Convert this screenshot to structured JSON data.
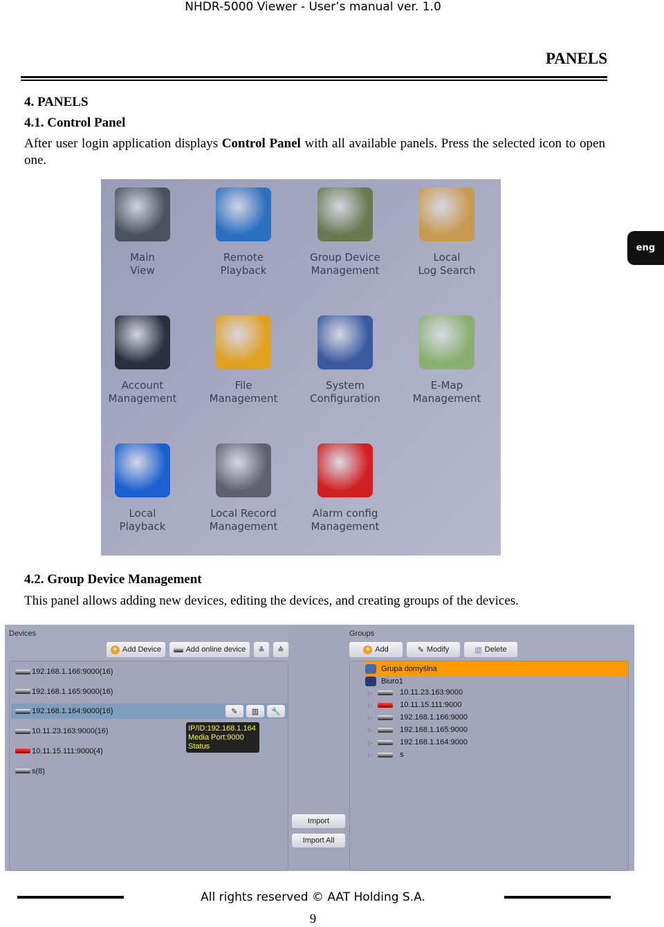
{
  "header": {
    "title": "NHDR-5000 Viewer - User’s manual ver. 1.0",
    "section": "PANELS"
  },
  "lang_tab": "eng",
  "s4": {
    "heading": "4. PANELS",
    "sub": "4.1. Control Panel",
    "p_a": "After user login application displays ",
    "p_bold": "Control Panel",
    "p_b": " with all available panels. Press the selected icon to open one."
  },
  "control_panel": {
    "tiles": [
      {
        "l1": "Main",
        "l2": "View",
        "icon": "monitor-icon",
        "color": "#4a5260"
      },
      {
        "l1": "Remote",
        "l2": "Playback",
        "icon": "playback-arrow-icon",
        "color": "#2a6fc0"
      },
      {
        "l1": "Group Device",
        "l2": "Management",
        "icon": "camera-film-icon",
        "color": "#6a7a50"
      },
      {
        "l1": "Local",
        "l2": "Log Search",
        "icon": "clipboard-pen-icon",
        "color": "#c89a50"
      },
      {
        "l1": "Account",
        "l2": "Management",
        "icon": "users-icon",
        "color": "#2a3040"
      },
      {
        "l1": "File",
        "l2": "Management",
        "icon": "folder-icon",
        "color": "#e0a020"
      },
      {
        "l1": "System",
        "l2": "Configuration",
        "icon": "gear-icon",
        "color": "#3a5aa0"
      },
      {
        "l1": "E-Map",
        "l2": "Management",
        "icon": "map-icon",
        "color": "#8ab070"
      },
      {
        "l1": "Local",
        "l2": "Playback",
        "icon": "play-disk-icon",
        "color": "#1a60d0"
      },
      {
        "l1": "Local Record",
        "l2": "Management",
        "icon": "film-reel-icon",
        "color": "#606070"
      },
      {
        "l1": "Alarm config",
        "l2": "Management",
        "icon": "alarm-siren-icon",
        "color": "#d02020"
      }
    ]
  },
  "s42": {
    "heading": "4.2. Group Device Management",
    "p": "This panel allows adding new devices, editing the devices, and creating groups of the devices."
  },
  "devices": {
    "title": "Devices",
    "add_device": "Add Device",
    "add_online": "Add online device",
    "expand": "≚",
    "collapse": "≙",
    "items": [
      {
        "label": "192.168.1.166:9000(16)"
      },
      {
        "label": "192.168.1.165:9000(16)"
      },
      {
        "label": "192.168.1.164:9000(16)",
        "selected": true
      },
      {
        "label": "10.11.23.163:9000(16)"
      },
      {
        "label": "10.11.15.111:9000(4)",
        "red": true
      },
      {
        "label": "s(8)"
      }
    ],
    "tooltip": {
      "l1": "IP/ID:192.168.1.164",
      "l2": "Media Port:9000",
      "l3": "Status"
    },
    "import": "Import",
    "import_all": "Import All"
  },
  "groups": {
    "title": "Groups",
    "add": "Add",
    "modify": "Modify",
    "delete": "Delete",
    "selected_color": "#ff9900",
    "g1": "Grupa domyślna",
    "g2": "Biuro1",
    "items": [
      {
        "label": "10.11.23.163:9000"
      },
      {
        "label": "10.11.15.111:9000",
        "red": true
      },
      {
        "label": "192.168.1.166:9000"
      },
      {
        "label": "192.168.1.165:9000"
      },
      {
        "label": "192.168.1.164:9000"
      },
      {
        "label": "s"
      }
    ]
  },
  "footer": {
    "rights": "All rights reserved © AAT Holding S.A.",
    "page": "9"
  }
}
